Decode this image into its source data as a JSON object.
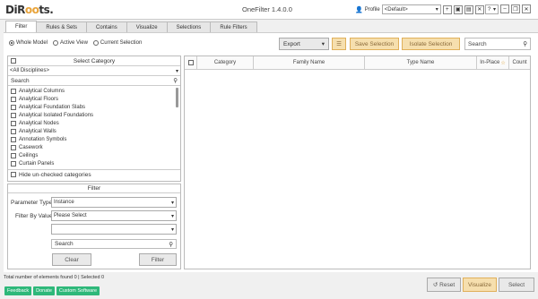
{
  "header": {
    "logo_main": "DiR",
    "logo_accent": "oo",
    "logo_tail": "ts.",
    "title": "OneFilter 1.4.0.0",
    "profile_label": "Profile",
    "profile_value": "<Default>",
    "help_label": "?"
  },
  "tabs": [
    "Filter",
    "Rules & Sets",
    "Contains",
    "Visualize",
    "Selections",
    "Rule Filters"
  ],
  "scope": {
    "whole_model": "Whole Model",
    "active_view": "Active View",
    "current_selection": "Current Selection"
  },
  "toolbar": {
    "export_label": "Export",
    "save_selection": "Save Selection",
    "isolate_selection": "Isolate Selection",
    "search_placeholder": "Search"
  },
  "category_panel": {
    "header": "Select Category",
    "discipline": "<All Disciplines>",
    "search_placeholder": "Search",
    "items": [
      "Analytical Columns",
      "Analytical Floors",
      "Analytical Foundation Slabs",
      "Analytical Isolated Foundations",
      "Analytical Nodes",
      "Analytical Walls",
      "Annotation Symbols",
      "Casework",
      "Ceilings",
      "Curtain Panels"
    ],
    "hide_unchecked": "Hide un-checked categories"
  },
  "filter_panel": {
    "header": "Filter",
    "param_type_label": "Parameter Type",
    "param_type_value": "Instance",
    "filter_by_label": "Filter By Value",
    "filter_by_value": "Please Select",
    "value_search_placeholder": "Search",
    "clear": "Clear",
    "filter": "Filter"
  },
  "table": {
    "columns": [
      "Category",
      "Family Name",
      "Type Name",
      "In-Place",
      "Count"
    ]
  },
  "footer": {
    "status": "Total number of elements found 0 | Selected 0",
    "links": [
      "Feedback",
      "Donate",
      "Custom Software"
    ],
    "reset": "Reset",
    "visualize": "Visualize",
    "select": "Select"
  }
}
